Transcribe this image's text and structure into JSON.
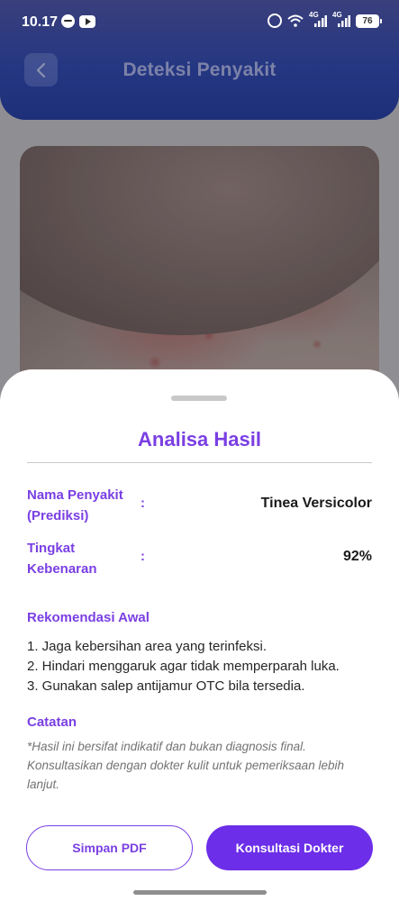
{
  "status_bar": {
    "time": "10.17",
    "battery": "76",
    "network_1": "4G",
    "network_2": "4G"
  },
  "header": {
    "title": "Deteksi Penyakit"
  },
  "sheet": {
    "title": "Analisa Hasil",
    "disease_label": "Nama Penyakit (Prediksi)",
    "disease_colon": ":",
    "disease_value": "Tinea Versicolor",
    "accuracy_label": "Tingkat Kebenaran",
    "accuracy_colon": ":",
    "accuracy_value": "92%",
    "recommendation_heading": "Rekomendasi Awal",
    "recommendations": [
      "1. Jaga kebersihan area yang terinfeksi.",
      "2. Hindari menggaruk agar tidak memperparah luka.",
      "3. Gunakan salep antijamur OTC bila tersedia."
    ],
    "note_heading": "Catatan",
    "note_text": "*Hasil ini bersifat indikatif dan bukan diagnosis final. Konsultasikan dengan dokter kulit untuk pemeriksaan lebih lanjut.",
    "save_pdf_label": "Simpan PDF",
    "consult_label": "Konsultasi Dokter"
  },
  "colors": {
    "accent": "#7a3fe3",
    "primary_button": "#6c2ee8",
    "header_bg": "#253782"
  }
}
